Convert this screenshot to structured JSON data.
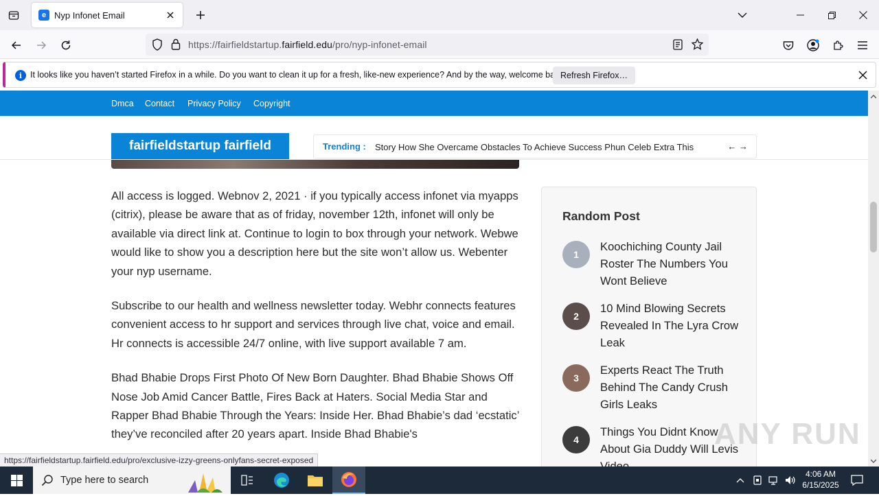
{
  "browser": {
    "tab_title": "Nyp Infonet Email",
    "url_prefix": "https://fairfieldstartup.",
    "url_domain": "fairfield.edu",
    "url_path": "/pro/nyp-infonet-email"
  },
  "notification": {
    "message": "It looks like you haven’t started Firefox in a while. Do you want to clean it up for a fresh, like-new experience? And by the way, welcome back!",
    "button": "Refresh Firefox…"
  },
  "site": {
    "topnav": [
      "Dmca",
      "Contact",
      "Privacy Policy",
      "Copyright"
    ],
    "logo": "fairfieldstartup fairfield",
    "trending_label": "Trending :",
    "trending_text": "Story How She Overcame Obstacles To Achieve Success  Phun Celeb Extra This",
    "trending_arrows": "← →"
  },
  "article": {
    "paragraphs": [
      "All access is logged. Webnov 2, 2021 · if you typically access infonet via myapps (citrix), please be aware that as of friday, november 12th, infonet will only be available via direct link at. Continue to login to box through your network. Webwe would like to show you a description here but the site won’t allow us. Webenter your nyp username.",
      "Subscribe to our health and wellness newsletter today. Webhr connects features convenient access to hr support and services through live chat, voice and email. Hr connects is accessible 24/7 online, with live support available 7 am.",
      "Bhad Bhabie Drops First Photo Of New Born Daughter. Bhad Bhabie Shows Off Nose Job Amid Cancer Battle, Fires Back at Haters. Social Media Star and Rapper Bhad Bhabie Through the Years: Inside Her. Bhad Bhabie’s dad ‘ecstatic’ they’ve reconciled after 20 years apart. Inside Bhad Bhabie's"
    ]
  },
  "sidebar": {
    "title": "Random Post",
    "posts": [
      {
        "num": "1",
        "title": "Koochiching County Jail Roster The Numbers You Wont Believe"
      },
      {
        "num": "2",
        "title": "10 Mind Blowing Secrets Revealed In The Lyra Crow Leak"
      },
      {
        "num": "3",
        "title": "Experts React The Truth Behind The Candy Crush Girls Leaks"
      },
      {
        "num": "4",
        "title": "Things You Didnt Know About Gia Duddy Will Levis Video"
      }
    ]
  },
  "status_url": "https://fairfieldstartup.fairfield.edu/pro/exclusive-izzy-greens-onlyfans-secret-exposed",
  "watermark": "ANY RUN",
  "taskbar": {
    "search_placeholder": "Type here to search",
    "time": "4:06 AM",
    "date": "6/15/2025"
  }
}
